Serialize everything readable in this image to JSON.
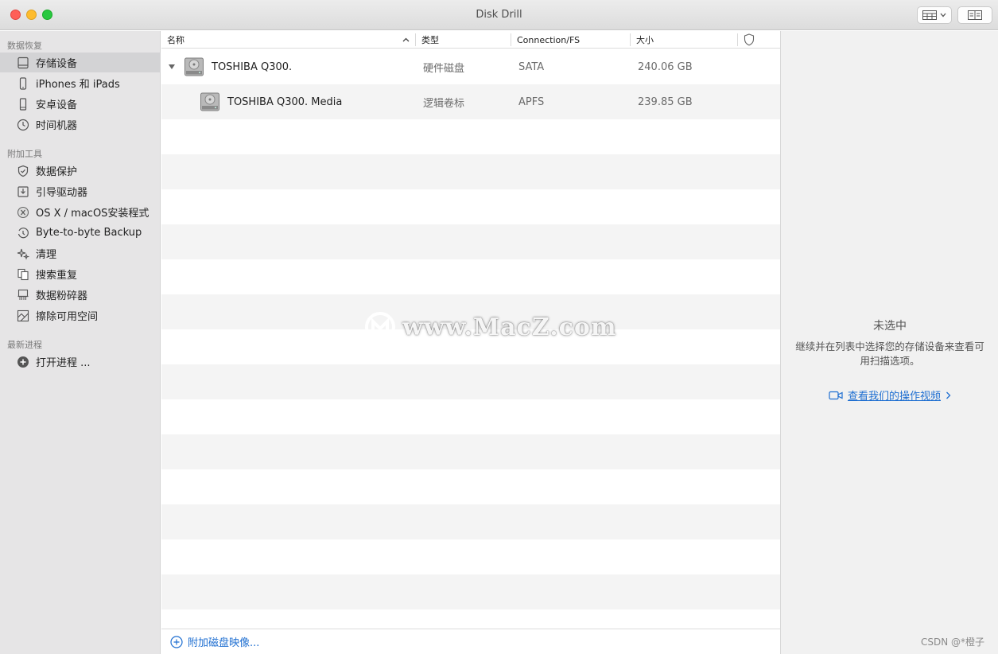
{
  "window": {
    "title": "Disk Drill"
  },
  "sidebar": {
    "sections": [
      {
        "label": "数据恢复"
      },
      {
        "label": "附加工具"
      },
      {
        "label": "最新进程"
      }
    ],
    "recovery_items": [
      {
        "label": "存储设备",
        "icon": "drive-icon"
      },
      {
        "label": "iPhones 和 iPads",
        "icon": "iphone-icon"
      },
      {
        "label": "安卓设备",
        "icon": "android-phone-icon"
      },
      {
        "label": "时间机器",
        "icon": "time-machine-icon"
      }
    ],
    "tool_items": [
      {
        "label": "数据保护",
        "icon": "shield-icon"
      },
      {
        "label": "引导驱动器",
        "icon": "boot-drive-icon"
      },
      {
        "label": "OS X / macOS安装程式",
        "icon": "macos-installer-icon"
      },
      {
        "label": "Byte-to-byte Backup",
        "icon": "backup-clock-icon"
      },
      {
        "label": "清理",
        "icon": "sparkle-icon"
      },
      {
        "label": "搜索重复",
        "icon": "duplicate-files-icon"
      },
      {
        "label": "数据粉碎器",
        "icon": "shredder-icon"
      },
      {
        "label": "擦除可用空间",
        "icon": "erase-space-icon"
      }
    ],
    "session_items": [
      {
        "label": "打开进程 ...",
        "icon": "plus-circle-icon"
      }
    ]
  },
  "table": {
    "columns": {
      "name": "名称",
      "type": "类型",
      "connection": "Connection/FS",
      "size": "大小"
    },
    "rows": [
      {
        "name": "TOSHIBA Q300.",
        "type": "硬件磁盘",
        "connection": "SATA",
        "size": "240.06 GB"
      },
      {
        "name": "TOSHIBA Q300. Media",
        "type": "逻辑卷标",
        "connection": "APFS",
        "size": "239.85 GB"
      }
    ],
    "footer_link": "附加磁盘映像..."
  },
  "detail": {
    "title": "未选中",
    "description": "继续并在列表中选择您的存储设备来查看可用扫描选项。",
    "link": "查看我们的操作视频"
  },
  "watermark": "www.MacZ.com",
  "credit": "CSDN @*橙子"
}
